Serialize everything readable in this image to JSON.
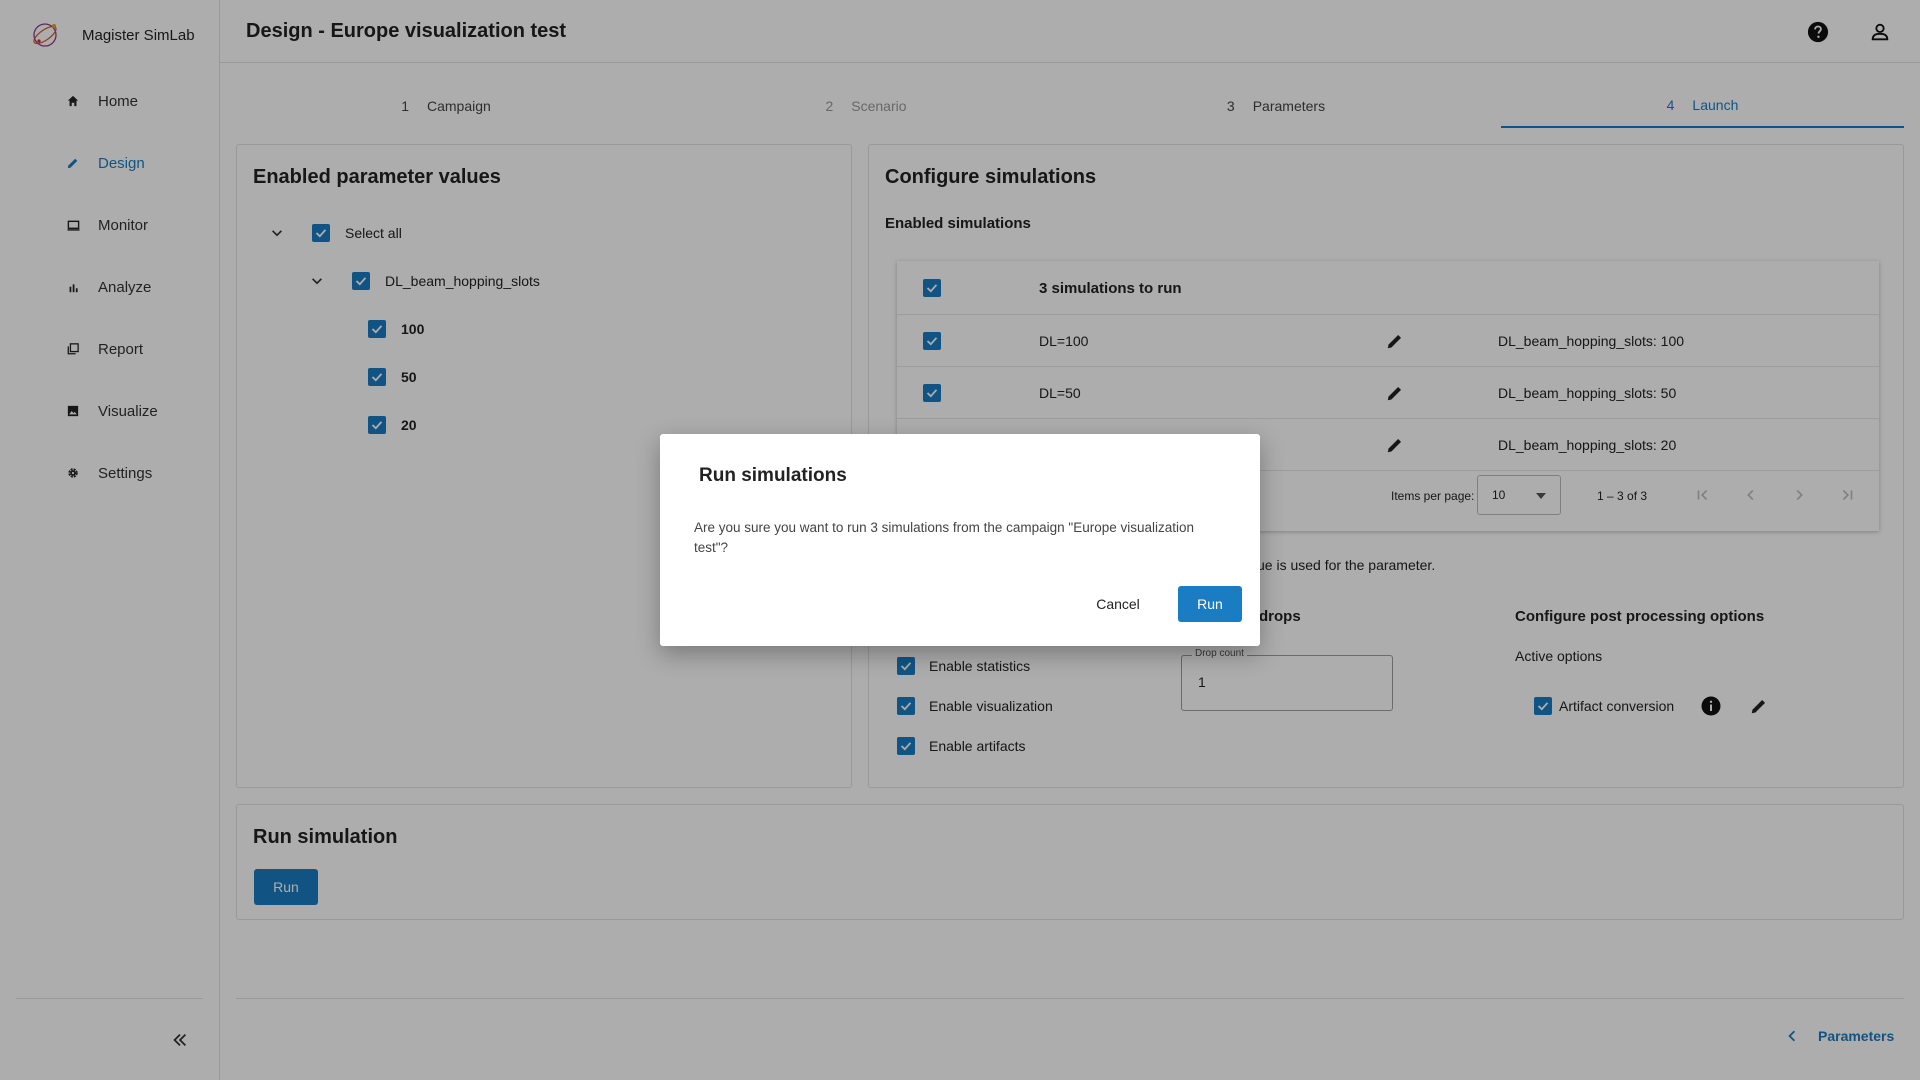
{
  "app": {
    "name": "Magister SimLab"
  },
  "sidebar": {
    "items": [
      {
        "label": "Home",
        "icon": "home-icon"
      },
      {
        "label": "Design",
        "icon": "pencil-icon",
        "active": true
      },
      {
        "label": "Monitor",
        "icon": "monitor-icon"
      },
      {
        "label": "Analyze",
        "icon": "bar-chart-icon"
      },
      {
        "label": "Report",
        "icon": "report-icon"
      },
      {
        "label": "Visualize",
        "icon": "image-icon"
      },
      {
        "label": "Settings",
        "icon": "gear-icon"
      }
    ],
    "collapse_icon": "double-chevron-left-icon"
  },
  "header": {
    "title": "Design - Europe visualization test"
  },
  "stepper": {
    "steps": [
      {
        "num": "1",
        "label": "Campaign"
      },
      {
        "num": "2",
        "label": "Scenario",
        "disabled": true
      },
      {
        "num": "3",
        "label": "Parameters"
      },
      {
        "num": "4",
        "label": "Launch",
        "active": true
      }
    ]
  },
  "params": {
    "title": "Enabled parameter values",
    "select_all": "Select all",
    "group": "DL_beam_hopping_slots",
    "values": [
      "100",
      "50",
      "20"
    ]
  },
  "config": {
    "title": "Configure simulations",
    "enabled_label": "Enabled simulations",
    "table_header": "3 simulations to run",
    "rows": [
      {
        "name": "DL=100",
        "params": "DL_beam_hopping_slots: 100"
      },
      {
        "name": "DL=50",
        "params": "DL_beam_hopping_slots: 50"
      },
      {
        "name": "",
        "params": "DL_beam_hopping_slots: 20"
      }
    ],
    "items_per_page_label": "Items per page:",
    "items_per_page": "10",
    "range": "1 – 3 of 3",
    "note_fragment": "ue is used for the parameter.",
    "drops_heading_fragment": "drops",
    "options": [
      "Enable statistics",
      "Enable visualization",
      "Enable artifacts"
    ],
    "drop_count_label": "Drop count",
    "drop_count_value": "1",
    "post_title": "Configure post processing options",
    "active_options": "Active options",
    "artifact": "Artifact conversion"
  },
  "run_card": {
    "title": "Run simulation",
    "button": "Run"
  },
  "footer": {
    "back_label": "Parameters"
  },
  "dialog": {
    "title": "Run simulations",
    "message": "Are you sure you want to run 3 simulations from the campaign \"Europe visualization test\"?",
    "cancel": "Cancel",
    "confirm": "Run"
  },
  "colors": {
    "accent": "#1a7cc2",
    "overlay": "rgba(0,0,0,0.32)"
  }
}
